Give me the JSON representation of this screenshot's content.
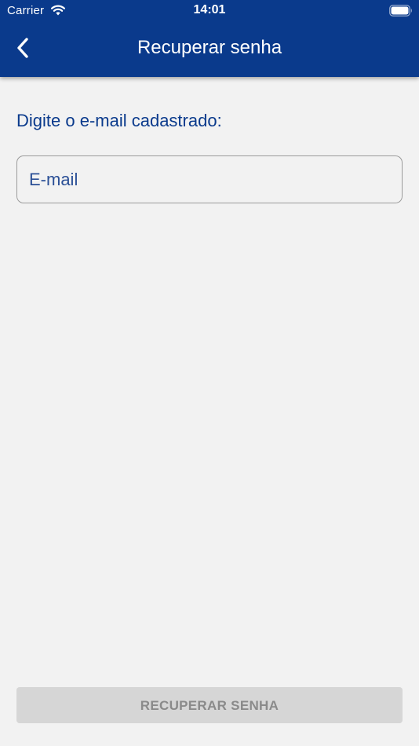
{
  "status_bar": {
    "carrier": "Carrier",
    "time": "14:01",
    "wifi_icon": "wifi-icon",
    "battery_icon": "battery-icon"
  },
  "header": {
    "back_icon": "chevron-left-icon",
    "title": "Recuperar senha",
    "background_color": "#0a3a8c"
  },
  "form": {
    "prompt": "Digite o e-mail cadastrado:",
    "email": {
      "value": "",
      "placeholder": "E-mail"
    },
    "submit_label": "RECUPERAR SENHA",
    "submit_enabled": false
  },
  "colors": {
    "accent": "#0a3a8c",
    "background": "#f2f2f2",
    "button_disabled_bg": "#d6d6d6",
    "button_disabled_text": "#8a8a8a"
  }
}
